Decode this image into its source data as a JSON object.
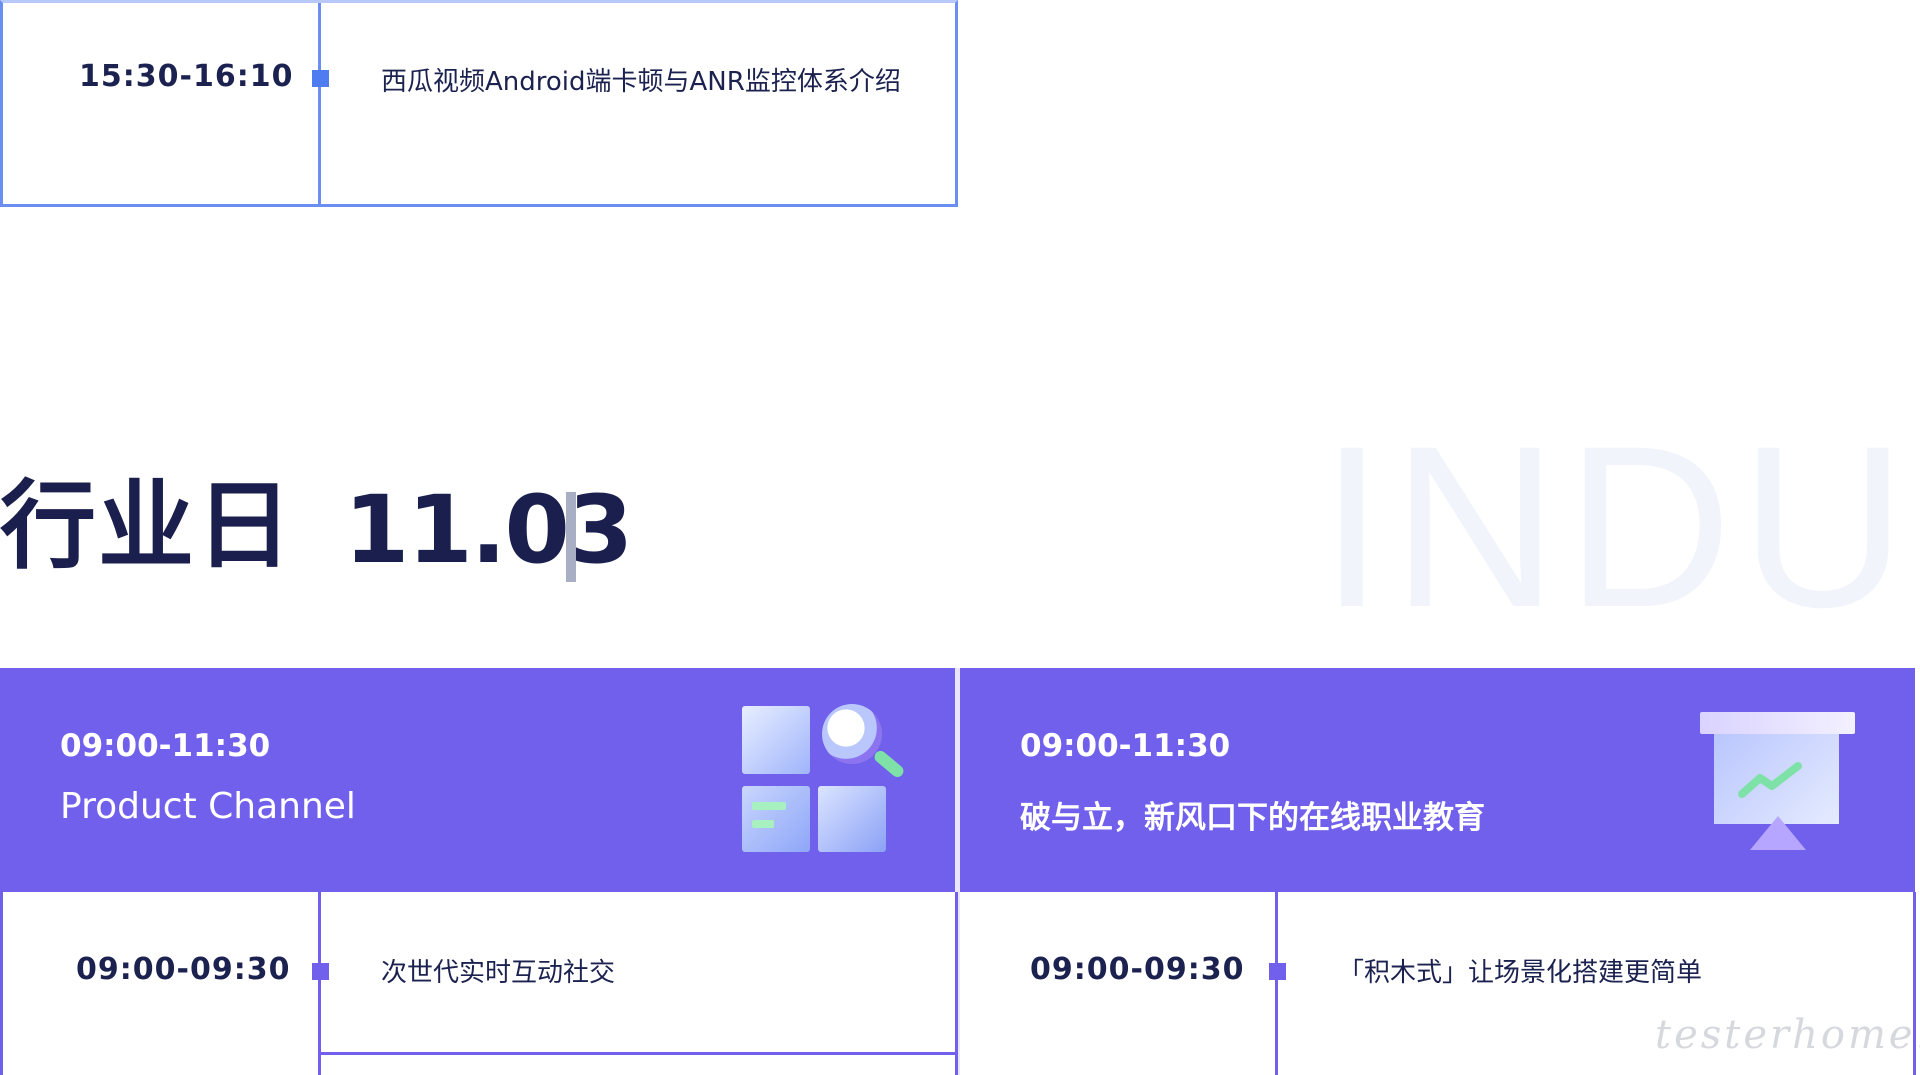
{
  "top_session": {
    "time": "15:30-16:10",
    "title": "西瓜视频Android端卡顿与ANR监控体系介绍"
  },
  "section": {
    "title": "行业日",
    "date": "11.03",
    "bg_word": "INDU"
  },
  "channels": [
    {
      "time": "09:00-11:30",
      "name": "Product Channel",
      "icon": "search-grid-illustration",
      "sessions": [
        {
          "time": "09:00-09:30",
          "title": "次世代实时互动社交"
        }
      ]
    },
    {
      "time": "09:00-11:30",
      "name": "破与立，新风口下的在线职业教育",
      "icon": "presentation-chart-illustration",
      "sessions": [
        {
          "time": "09:00-09:30",
          "title": "「积木式」让场景化搭建更简单"
        }
      ]
    }
  ],
  "watermark": "testerhome.com",
  "colors": {
    "accent_blue": "#4f7cf0",
    "accent_purple": "#7060ec",
    "title_navy": "#1a1f4d"
  }
}
